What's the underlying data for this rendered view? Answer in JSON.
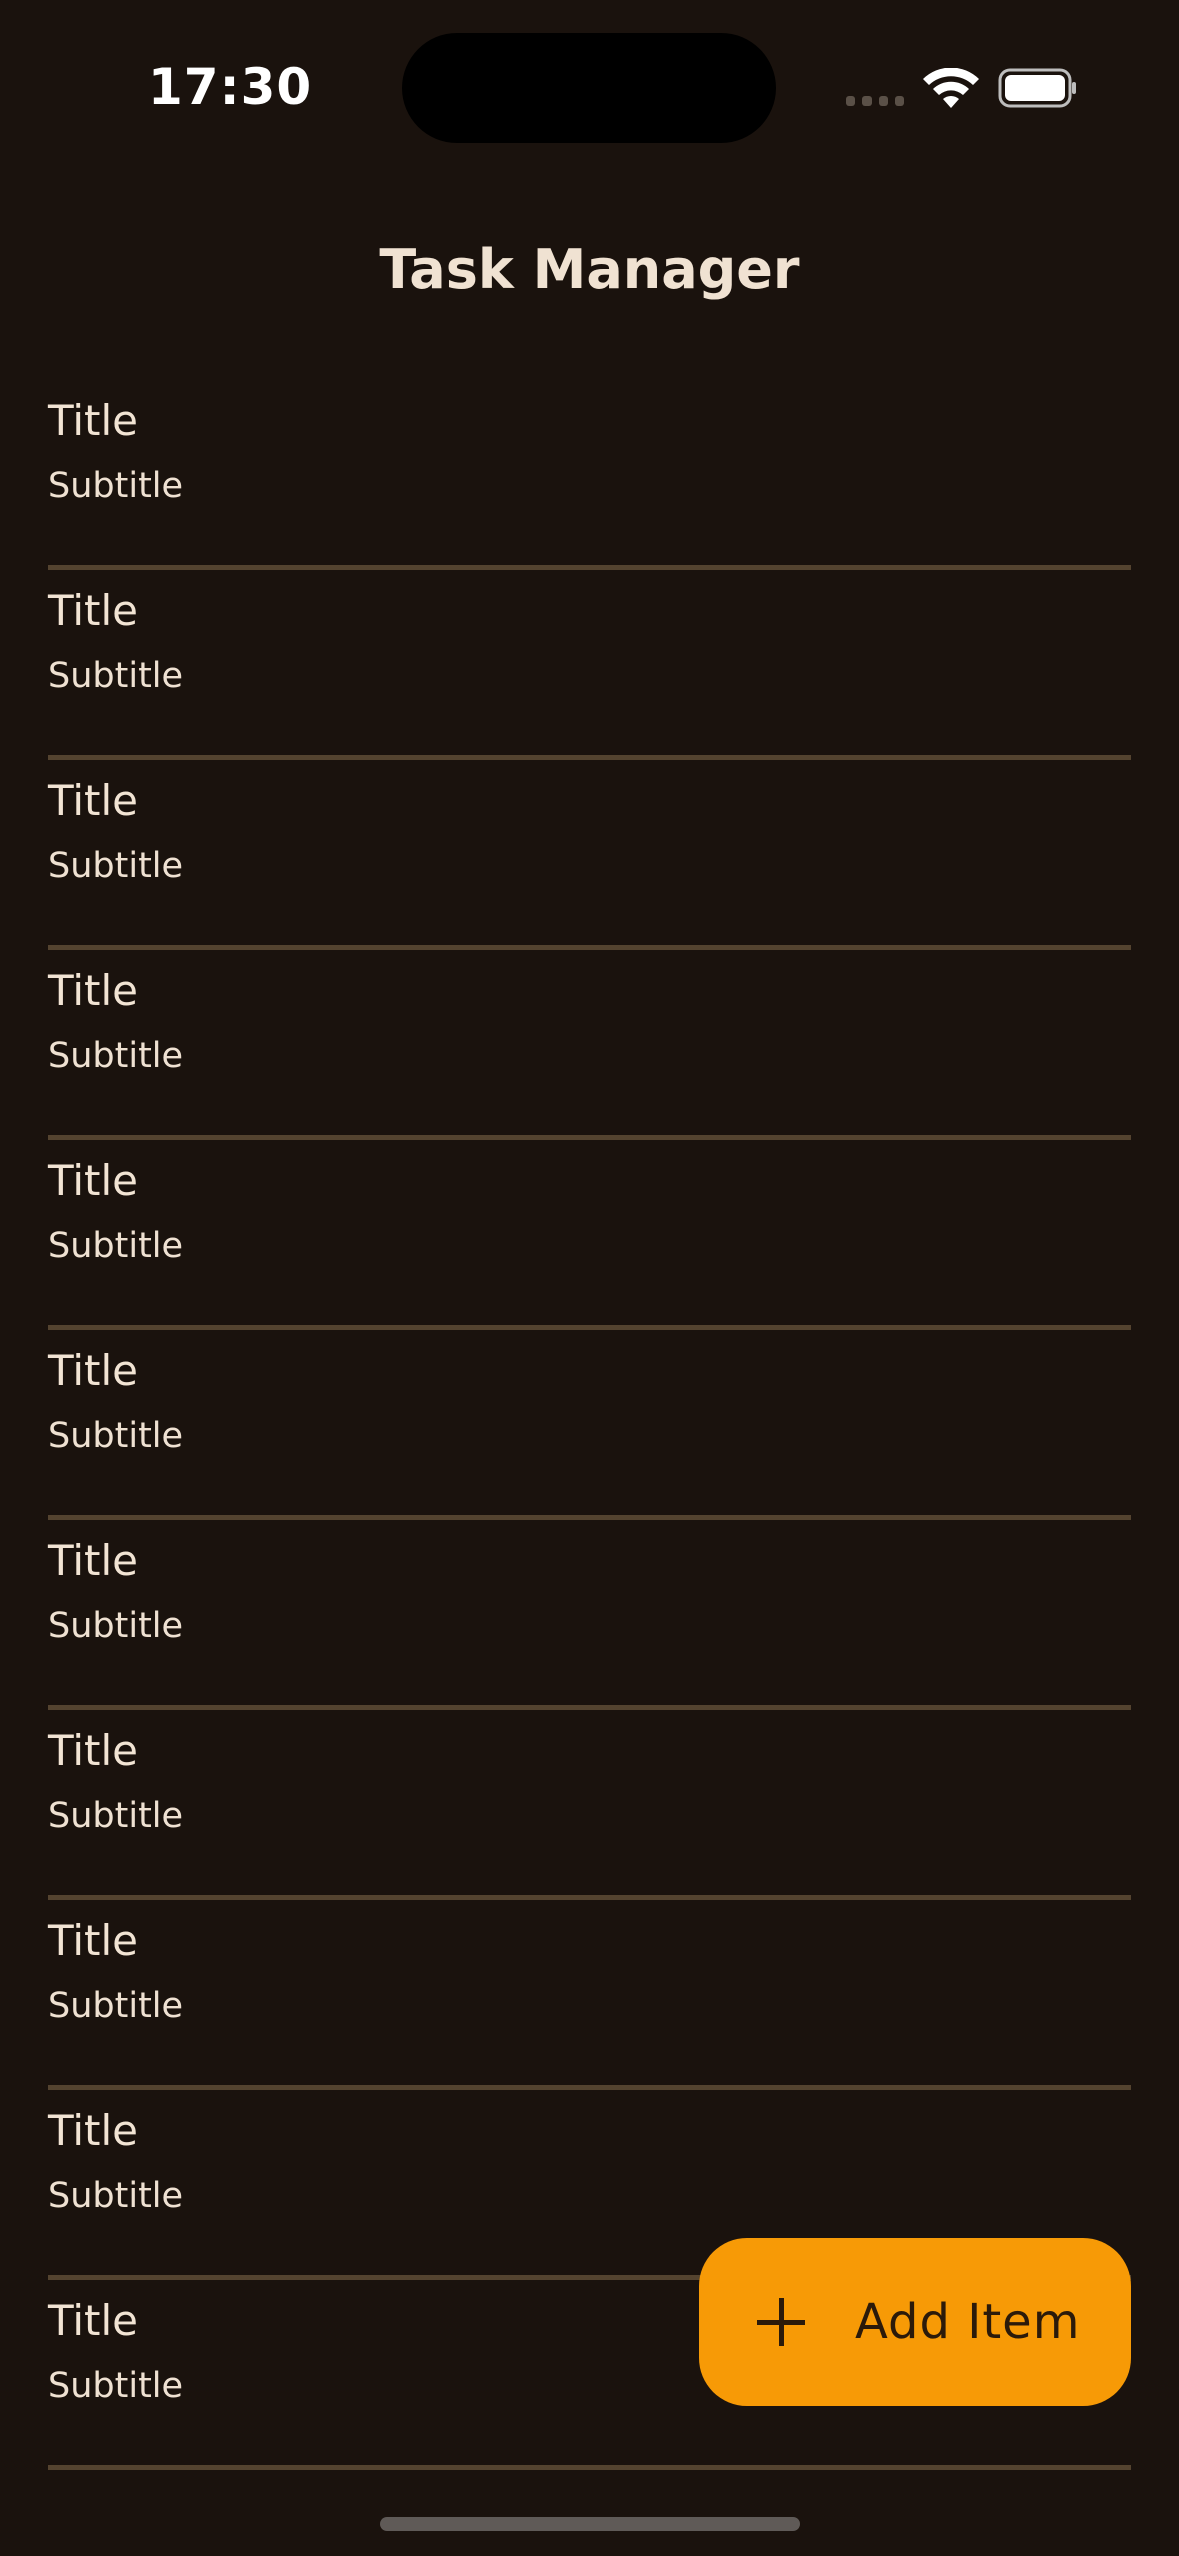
{
  "status_bar": {
    "time": "17:30",
    "icons": [
      "signal-icon",
      "wifi-icon",
      "battery-icon"
    ]
  },
  "header": {
    "title": "Task Manager"
  },
  "list": {
    "items": [
      {
        "title": "Title",
        "subtitle": "Subtitle"
      },
      {
        "title": "Title",
        "subtitle": "Subtitle"
      },
      {
        "title": "Title",
        "subtitle": "Subtitle"
      },
      {
        "title": "Title",
        "subtitle": "Subtitle"
      },
      {
        "title": "Title",
        "subtitle": "Subtitle"
      },
      {
        "title": "Title",
        "subtitle": "Subtitle"
      },
      {
        "title": "Title",
        "subtitle": "Subtitle"
      },
      {
        "title": "Title",
        "subtitle": "Subtitle"
      },
      {
        "title": "Title",
        "subtitle": "Subtitle"
      },
      {
        "title": "Title",
        "subtitle": "Subtitle"
      },
      {
        "title": "Title",
        "subtitle": "Subtitle"
      }
    ]
  },
  "fab": {
    "label": "Add Item",
    "icon": "plus-icon"
  },
  "colors": {
    "background": "#1a120d",
    "divider": "#54432f",
    "accent": "#f79a06",
    "text": "#f2e4d4"
  }
}
